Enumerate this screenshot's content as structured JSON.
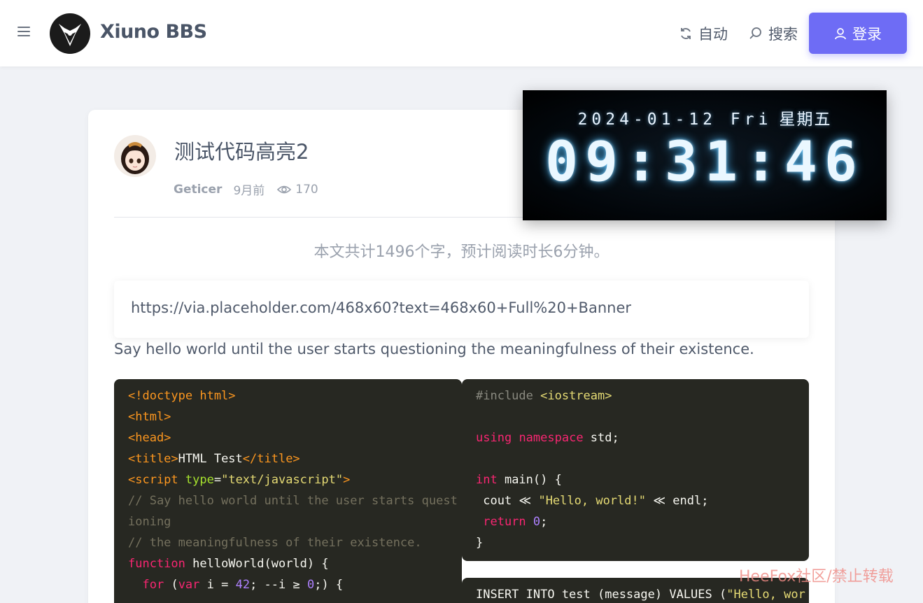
{
  "header": {
    "brand": "Xiuno BBS",
    "menu_icon": "hamburger-icon",
    "nav": {
      "auto_label": "自动",
      "auto_icon": "refresh-icon",
      "search_label": "搜索",
      "search_icon": "search-icon"
    },
    "login_label": "登录",
    "login_icon": "user-icon",
    "accent_color": "#6e6cf5"
  },
  "post": {
    "title": "测试代码高亮2",
    "author": "Geticer",
    "time": "9月前",
    "views": "170",
    "word_count_notice": "本文共计1496个字，预计阅读时长6分钟。",
    "url_text": "https://via.placeholder.com/468x60?text=468x60+Full%20+Banner",
    "paragraph": "Say hello world until the user starts questioning the meaningfulness of their existence."
  },
  "code_html": {
    "l1": "<!doctype html>",
    "l2": "<html>",
    "l3": "<head>",
    "l4_open": "<title>",
    "l4_text": "HTML Test",
    "l4_close": "</title>",
    "l5_open": "<script ",
    "l5_attr": "type",
    "l5_eq": "=",
    "l5_val": "\"text/javascript\"",
    "l5_close": ">",
    "l6": "// Say hello world until the user starts quest",
    "l7": "ioning",
    "l8": "// the meaningfulness of their existence.",
    "l9_kw": "function",
    "l9_fn": " helloWorld",
    "l9_rest": "(world) {",
    "l10_indent": "  ",
    "l10_for": "for",
    "l10_p1": " (",
    "l10_var": "var",
    "l10_p2": " i = ",
    "l10_n1": "42",
    "l10_p3": "; --i ≥ ",
    "l10_n2": "0",
    "l10_p4": ";) {"
  },
  "code_cpp": {
    "l1_pre": "#include ",
    "l1_lib": "<iostream>",
    "l3_kw1": "using",
    "l3_kw2": "namespace",
    "l3_rest": " std;",
    "l5_kw": "int",
    "l5_rest": " main() {",
    "l6_a": " cout ≪ ",
    "l6_str": "\"Hello, world!\"",
    "l6_b": " ≪ endl;",
    "l7_kw": " return",
    "l7_sp": " ",
    "l7_num": "0",
    "l7_end": ";",
    "l8": "}"
  },
  "code_sql": {
    "l1_a": "INSERT INTO test (message) VALUES (",
    "l1_str": "\"Hello, wor"
  },
  "clock": {
    "date": "2024-01-12 Fri",
    "weekday": "星期五",
    "time": "09:31:46"
  },
  "watermark": "HeeFox社区/禁止转载"
}
